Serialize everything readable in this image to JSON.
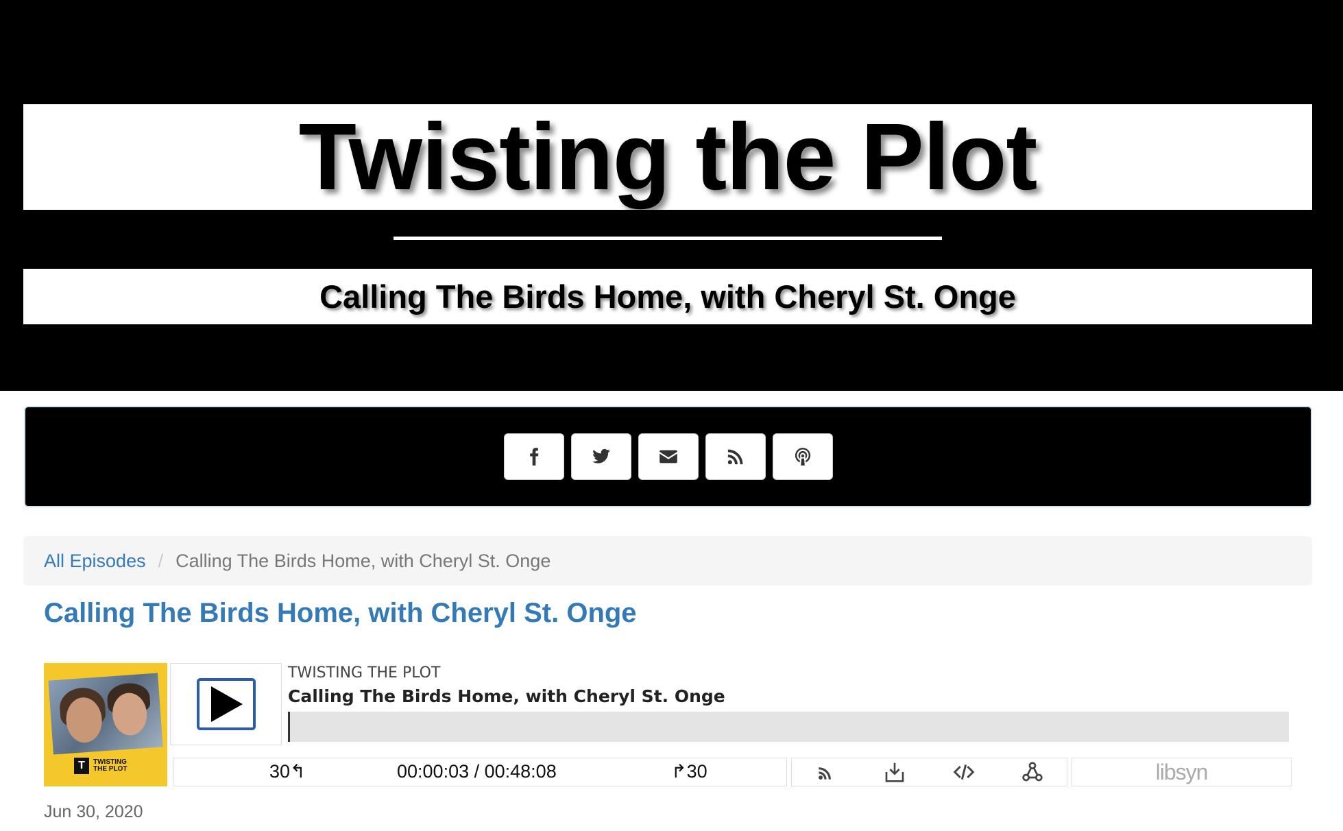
{
  "header": {
    "show_title": "Twisting the Plot",
    "episode_subtitle": "Calling The Birds Home, with Cheryl St. Onge"
  },
  "social": {
    "buttons": [
      {
        "icon": "facebook-icon"
      },
      {
        "icon": "twitter-icon"
      },
      {
        "icon": "envelope-icon"
      },
      {
        "icon": "rss-icon"
      },
      {
        "icon": "podcast-icon"
      }
    ]
  },
  "breadcrumb": {
    "home_label": "All Episodes",
    "separator": "/",
    "current": "Calling The Birds Home, with Cheryl St. Onge"
  },
  "episode": {
    "title": "Calling The Birds Home, with Cheryl St. Onge",
    "date": "Jun 30, 2020"
  },
  "player": {
    "cover_logo_letter": "T",
    "cover_logo_text_line1": "TWISTING",
    "cover_logo_text_line2": "THE PLOT",
    "show_name": "TWISTING THE PLOT",
    "episode_name": "Calling The Birds Home, with Cheryl St. Onge",
    "progress_fraction": 0.00104,
    "rewind_label": "30↰",
    "time_display": "00:00:03 / 00:48:08",
    "forward_label": "↱30",
    "brand": "libsyn",
    "accent_color": "#2a5db0"
  },
  "colors": {
    "link": "#337ab7",
    "hero_bg": "#000000"
  }
}
